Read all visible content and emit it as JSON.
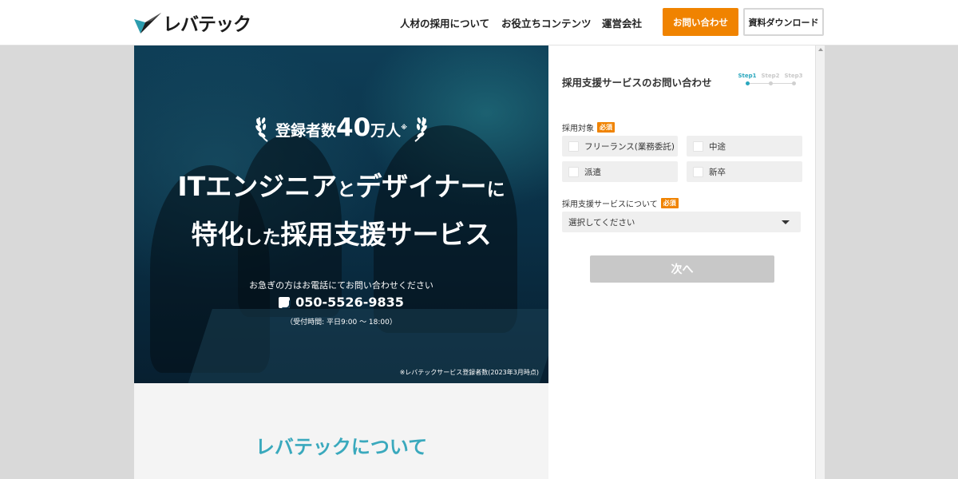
{
  "header": {
    "logo_text": "レバテック",
    "nav": [
      "人材の採用について",
      "お役立ちコンテンツ",
      "運営会社"
    ],
    "contact_button": "お問い合わせ",
    "download_button": "資料ダウンロード",
    "brand_color": "#f08300"
  },
  "hero": {
    "badge_prefix": "登録者数",
    "badge_number": "40",
    "badge_suffix": "万人",
    "badge_note": "※",
    "line1_a": "ITエンジニア",
    "line1_b": "と",
    "line1_c": "デザイナー",
    "line1_d": "に",
    "line2_a": "特化",
    "line2_b": "した",
    "line2_c": "採用支援サービス",
    "urgent_text": "お急ぎの方はお電話にてお問い合わせください",
    "phone": "050-5526-9835",
    "hours": "（受付時間: 平日9:00 ～ 18:00）",
    "footnote": "※レバテックサービス登録者数(2023年3月時点)"
  },
  "about": {
    "title": "レバテックについて",
    "title_color": "#3aa9bd"
  },
  "form": {
    "title": "採用支援サービスのお問い合わせ",
    "steps": [
      "Step1",
      "Step2",
      "Step3"
    ],
    "active_step": 1,
    "target_label": "採用対象",
    "required_label": "必須",
    "options": [
      "フリーランス(業務委託)",
      "中途",
      "派遣",
      "新卒"
    ],
    "service_label": "採用支援サービスについて",
    "select_placeholder": "選択してください",
    "next_button": "次へ",
    "accent_color": "#2aa7be"
  }
}
